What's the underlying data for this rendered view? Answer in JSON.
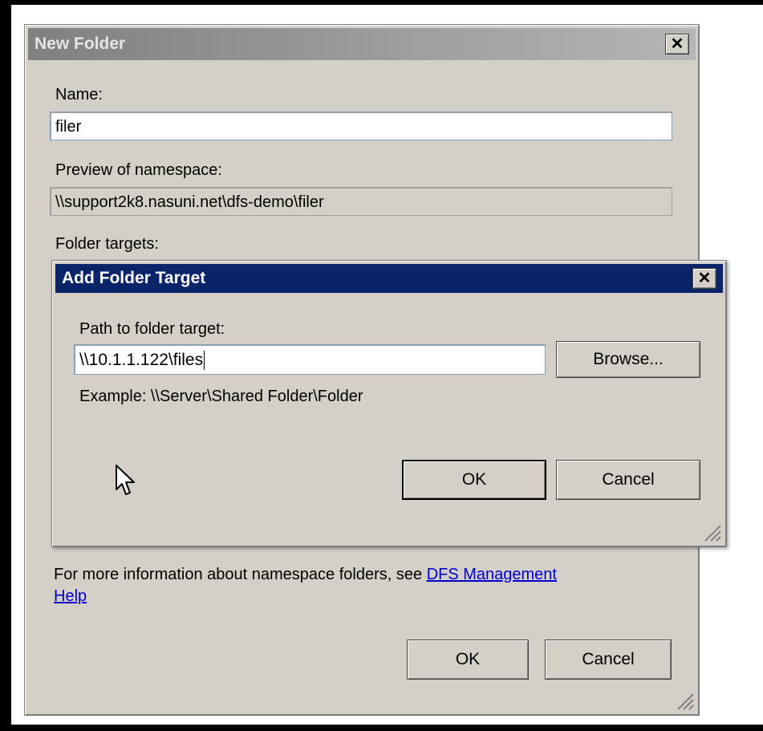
{
  "new_folder": {
    "title": "New Folder",
    "close_glyph": "✕",
    "name_label": "Name:",
    "name_value": "filer",
    "preview_label": "Preview of namespace:",
    "preview_value": "\\\\support2k8.nasuni.net\\dfs-demo\\filer",
    "targets_label": "Folder targets:",
    "help_text": "For more information about namespace folders, see ",
    "help_link_1": "DFS Management",
    "help_link_2": "Help",
    "ok_label": "OK",
    "cancel_label": "Cancel"
  },
  "add_target": {
    "title": "Add Folder Target",
    "close_glyph": "✕",
    "path_label": "Path to folder target:",
    "path_value": "\\\\10.1.1.122\\files",
    "browse_label": "Browse...",
    "example_text": "Example: \\\\Server\\Shared Folder\\Folder",
    "ok_label": "OK",
    "cancel_label": "Cancel"
  },
  "icons": {
    "cursor": "mouse-pointer-icon",
    "grip": "resize-grip-icon"
  },
  "colors": {
    "dialog_bg": "#d4d0c8",
    "active_title": "#0a246a",
    "inactive_title": "#808080",
    "link": "#0000cc"
  }
}
